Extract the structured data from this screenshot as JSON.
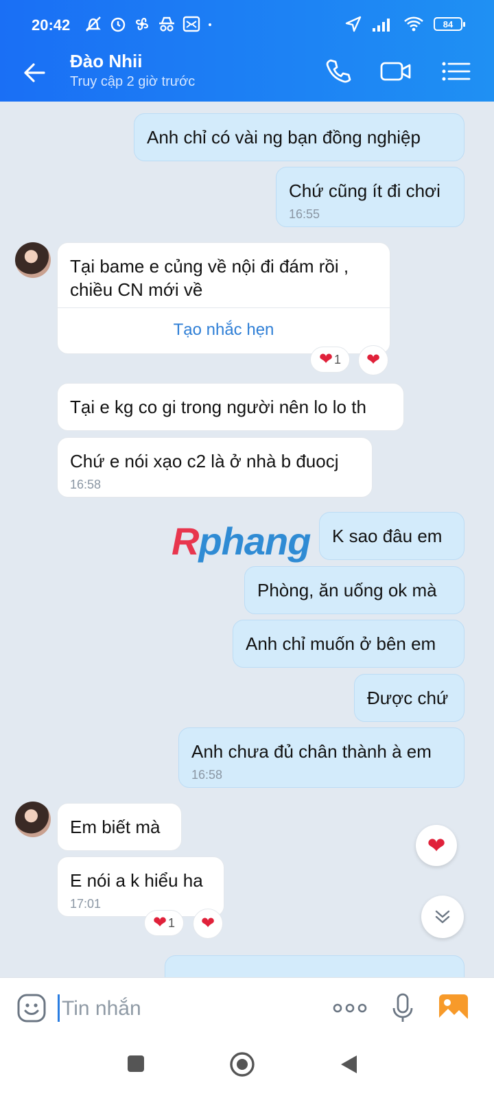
{
  "status_bar": {
    "time": "20:42",
    "battery": "84"
  },
  "header": {
    "contact_name": "Đào Nhii",
    "last_seen": "Truy cập 2 giờ trước"
  },
  "messages": [
    {
      "side": "out",
      "text": "Anh chỉ có vài ng bạn đồng nghiệp"
    },
    {
      "side": "out",
      "text": "Chứ cũng ít đi chơi",
      "time": "16:55"
    },
    {
      "side": "in",
      "line1": "Tại bame e củng về nội đi đám rồi ,",
      "line2": "chiều CN mới về",
      "action": "Tạo nhắc hẹn",
      "reaction_count": "1"
    },
    {
      "side": "in",
      "text": "Tại e kg co gi trong người nên lo lo th"
    },
    {
      "side": "in",
      "text": "Chứ e nói xạo c2 là ở nhà b đuocj",
      "time": "16:58"
    },
    {
      "side": "out",
      "text": "K sao đâu em"
    },
    {
      "side": "out",
      "text": "Phòng, ăn uống ok mà"
    },
    {
      "side": "out",
      "text": "Anh chỉ muốn ở bên em"
    },
    {
      "side": "out",
      "text": "Được chứ"
    },
    {
      "side": "out",
      "text": "Anh chưa đủ chân thành à em",
      "time": "16:58"
    },
    {
      "side": "in",
      "text": "Em biết mà"
    },
    {
      "side": "in",
      "text": "E nói a k hiểu ha",
      "time": "17:01",
      "reaction_count": "1"
    }
  ],
  "watermark": {
    "first": "R",
    "rest": "phang"
  },
  "composer": {
    "placeholder": "Tin nhắn"
  },
  "colors": {
    "header_start": "#1a6ff5",
    "header_end": "#1f90f3",
    "outgoing_bubble": "#d3ebfb",
    "heart": "#e0213a",
    "link": "#2f7fd6"
  }
}
